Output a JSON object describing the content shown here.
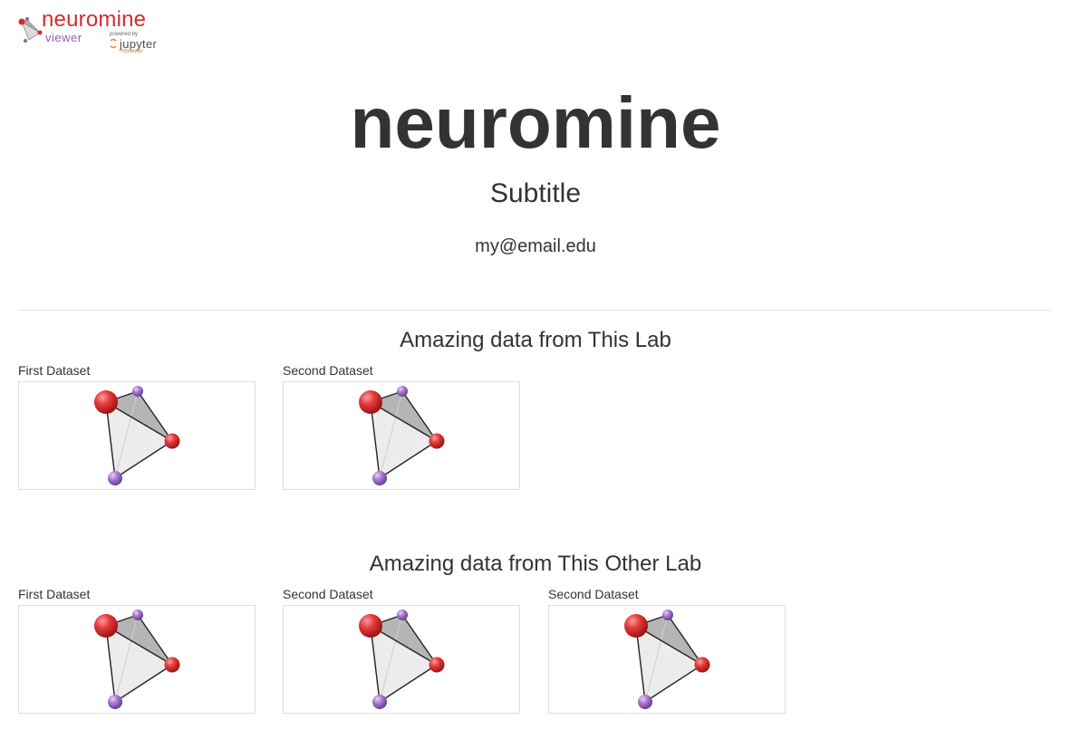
{
  "brand": {
    "name": "neuromine",
    "sub": "viewer",
    "powered_by": "powered by",
    "jupyter": "jupyter",
    "nbviewer": "nbviewer"
  },
  "title": "neuromine",
  "subtitle": "Subtitle",
  "email": "my@email.edu",
  "sections": [
    {
      "heading": "Amazing data from This Lab",
      "datasets": [
        {
          "label": "First Dataset"
        },
        {
          "label": "Second Dataset"
        }
      ]
    },
    {
      "heading": "Amazing data from This Other Lab",
      "datasets": [
        {
          "label": "First Dataset"
        },
        {
          "label": "Second Dataset"
        },
        {
          "label": "Second Dataset"
        }
      ]
    }
  ],
  "colors": {
    "brand_red": "#d22d2d",
    "brand_purple": "#9b59b6",
    "jupyter_orange": "#f37726",
    "text": "#333333"
  },
  "icons": {
    "logo": "molecule-logo-icon",
    "thumbnail": "tetrahedron-molecule-icon"
  }
}
